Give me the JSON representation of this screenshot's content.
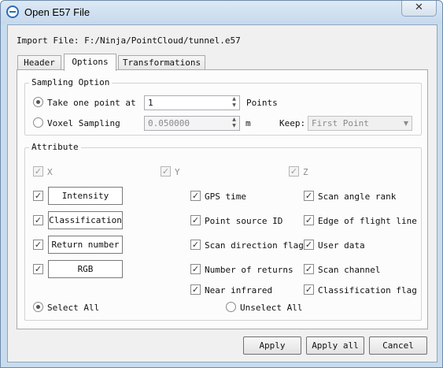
{
  "window": {
    "title": "Open E57 File",
    "close_glyph": "✕",
    "app_icon": "app-logo-icon"
  },
  "import": {
    "label": "Import File:",
    "path": "F:/Ninja/PointCloud/tunnel.e57"
  },
  "tabs": [
    {
      "label": "Header",
      "active": false
    },
    {
      "label": "Options",
      "active": true
    },
    {
      "label": "Transformations",
      "active": false
    }
  ],
  "sampling": {
    "title": "Sampling Option",
    "take_one_label": "Take one point at",
    "take_one_value": "1",
    "take_one_unit": "Points",
    "take_one_selected": true,
    "voxel_label": "Voxel Sampling",
    "voxel_value": "0.050000",
    "voxel_unit": "m",
    "voxel_selected": false,
    "keep_label": "Keep:",
    "keep_value": "First Point"
  },
  "attribute": {
    "title": "Attribute",
    "x_label": "X",
    "y_label": "Y",
    "z_label": "Z",
    "intensity": "Intensity",
    "classification": "Classification",
    "return_number": "Return number",
    "rgb": "RGB",
    "gps_time": "GPS time",
    "point_source_id": "Point source ID",
    "scan_direction_flag": "Scan direction flag",
    "number_of_returns": "Number of returns",
    "near_infrared": "Near infrared",
    "scan_angle_rank": "Scan angle rank",
    "edge_of_flight_line": "Edge of flight line",
    "user_data": "User data",
    "scan_channel": "Scan channel",
    "classification_flag": "Classification flag",
    "select_all": "Select All",
    "unselect_all": "Unselect All",
    "select_all_checked": true,
    "checkmark": "✓"
  },
  "buttons": {
    "apply": "Apply",
    "apply_all": "Apply all",
    "cancel": "Cancel"
  }
}
